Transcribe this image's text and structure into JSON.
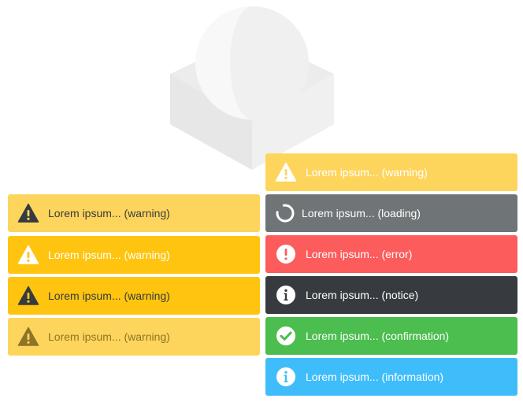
{
  "colors": {
    "yellow_light": "#fed55c",
    "yellow_strong": "#fec40f",
    "gray": "#6f7577",
    "red": "#fc5c5c",
    "dark": "#373b40",
    "green": "#4cbd4f",
    "blue": "#3fbdfa",
    "logo_gray": "#ececec"
  },
  "left_column": [
    {
      "text": "Lorem ipsum... (warning)",
      "icon": "warning-icon",
      "bg": "#fed55c",
      "fg": "#373b40",
      "icon_color": "#373b40"
    },
    {
      "text": "Lorem ipsum... (warning)",
      "icon": "warning-icon",
      "bg": "#fec40f",
      "fg": "#ffffff",
      "icon_color": "#ffffff"
    },
    {
      "text": "Lorem ipsum... (warning)",
      "icon": "warning-icon",
      "bg": "#fec40f",
      "fg": "#373b40",
      "icon_color": "#373b40"
    },
    {
      "text": "Lorem ipsum... (warning)",
      "icon": "warning-icon",
      "bg": "#fed55c",
      "fg": "#8d7426",
      "icon_color": "#8d7426"
    }
  ],
  "right_column": [
    {
      "text": "Lorem ipsum... (warning)",
      "icon": "warning-icon",
      "bg": "#fed55c",
      "fg": "#ffffff",
      "icon_color": "#ffffff"
    },
    {
      "text": "Lorem ipsum... (loading)",
      "icon": "spinner-icon",
      "bg": "#6f7577",
      "fg": "#ffffff",
      "icon_color": "#ffffff"
    },
    {
      "text": "Lorem ipsum... (error)",
      "icon": "error-icon",
      "bg": "#fc5c5c",
      "fg": "#ffffff",
      "icon_color": "#ffffff"
    },
    {
      "text": "Lorem ipsum... (notice)",
      "icon": "info-icon",
      "bg": "#373b40",
      "fg": "#ffffff",
      "icon_color": "#ffffff"
    },
    {
      "text": "Lorem ipsum... (confirmation)",
      "icon": "check-icon",
      "bg": "#4cbd4f",
      "fg": "#ffffff",
      "icon_color": "#ffffff"
    },
    {
      "text": "Lorem ipsum... (information)",
      "icon": "info-icon",
      "bg": "#3fbdfa",
      "fg": "#ffffff",
      "icon_color": "#ffffff"
    }
  ]
}
